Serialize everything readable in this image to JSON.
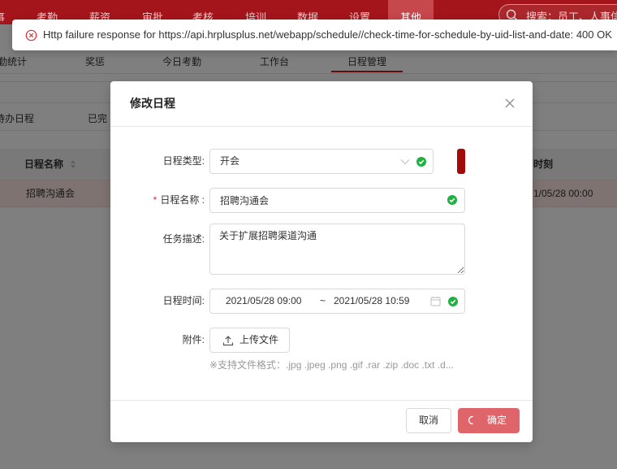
{
  "top_nav": {
    "background_color": "#a3151b",
    "active_index": 8,
    "items": [
      "事",
      "考勤",
      "薪资",
      "审批",
      "考核",
      "培训",
      "数据",
      "设置",
      "其他"
    ],
    "search": {
      "icon": "search-icon",
      "placeholder": "搜索：员工、人事信"
    }
  },
  "toast": {
    "type": "error",
    "icon": "error-circle-icon",
    "message": "Http failure response for https://api.hrplusplus.net/webapp/schedule//check-time-for-schedule-by-uid-list-and-date: 400 OK"
  },
  "sub_nav": {
    "active_index": 4,
    "items": [
      "勤统计",
      "奖惩",
      "今日考勤",
      "工作台",
      "日程管理"
    ]
  },
  "schedule_tabs": [
    "待办日程",
    "已完"
  ],
  "table": {
    "columns": [
      {
        "label": "日程名称",
        "sort_icon": "sort-icon"
      },
      {
        "label": "时刻"
      }
    ],
    "rows": [
      {
        "name": "招聘沟通会",
        "time": "1/05/28 00:00",
        "highlighted": true
      }
    ]
  },
  "modal": {
    "title": "修改日程",
    "close_icon": "close-icon",
    "form": {
      "type": {
        "label": "日程类型:",
        "value": "开会",
        "dropdown_icon": "chevron-down-icon",
        "valid": true,
        "color": "#a50a0a"
      },
      "name": {
        "required_mark": "*",
        "label": "日程名称 :",
        "value": "招聘沟通会",
        "valid": true
      },
      "description": {
        "label": "任务描述:",
        "value": "关于扩展招聘渠道沟通"
      },
      "time": {
        "label": "日程时间:",
        "start": "2021/05/28 09:00",
        "separator": "~",
        "end": "2021/05/28 10:59",
        "calendar_icon": "calendar-icon",
        "valid": true
      },
      "attachment": {
        "label": "附件:",
        "button_icon": "upload-icon",
        "button_label": "上传文件",
        "hint": "※支持文件格式：.jpg .jpeg .png .gif .rar .zip .doc .txt .d..."
      }
    },
    "footer": {
      "cancel_label": "取消",
      "ok_label": "确定",
      "ok_loading": true,
      "ok_color": "#e0656b"
    }
  },
  "validation_icon": "check-circle-icon"
}
